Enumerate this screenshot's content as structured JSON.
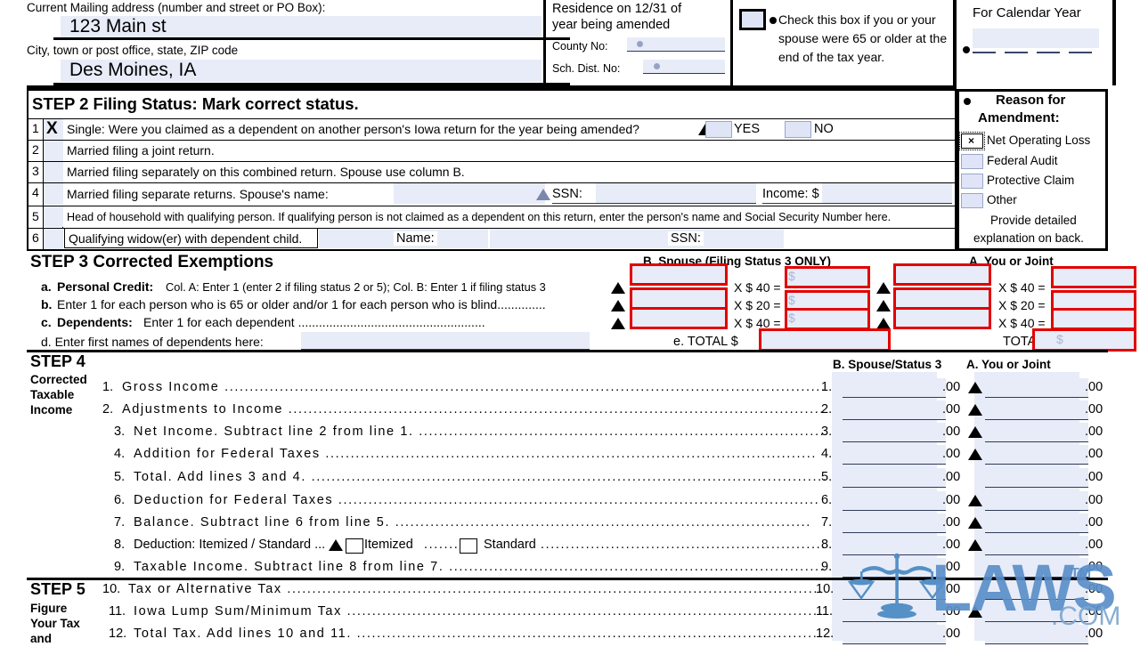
{
  "form": {
    "header": {
      "mailing_address_label": "Current Mailing address (number and street or PO Box):",
      "mailing_address_value": "123 Main st",
      "city_label": "City, town or post office, state, ZIP code",
      "city_value": "Des Moines, IA",
      "residence_label_line1": "Residence on 12/31 of",
      "residence_label_line2": "year being amended",
      "county_label": "County No:",
      "county_value": "",
      "school_label": "Sch. Dist. No:",
      "school_value": "",
      "age_check_text": "Check this box if you or your spouse were 65 or older at the end of the tax year.",
      "calendar_year_label": "For Calendar Year",
      "calendar_year_value": ""
    },
    "step2": {
      "title": "STEP 2 Filing Status: Mark correct status.",
      "rows": [
        {
          "num": "1",
          "mark": "X",
          "text": "Single: Were you claimed as a dependent on another person's Iowa return for the year being amended?"
        },
        {
          "num": "2",
          "mark": "",
          "text": "Married filing a joint return."
        },
        {
          "num": "3",
          "mark": "",
          "text": "Married filing separately on this combined return. Spouse use column B."
        },
        {
          "num": "4",
          "mark": "",
          "text": "Married filing separate returns. Spouse's name:"
        },
        {
          "num": "5",
          "mark": "",
          "text": "Head of household with qualifying person. If qualifying person is not claimed as a dependent on this return, enter the person's name and Social Security Number here."
        },
        {
          "num": "6",
          "mark": "",
          "text": "Qualifying widow(er) with dependent child."
        }
      ],
      "yes_label": "YES",
      "no_label": "NO",
      "ssn_label": "SSN:",
      "income_label": "Income: $",
      "name_label": "Name:",
      "ssn_label2": "SSN:"
    },
    "amendment": {
      "title_line1": "Reason for",
      "title_line2": "Amendment:",
      "options": [
        {
          "label": "Net Operating Loss",
          "checked": true
        },
        {
          "label": "Federal Audit",
          "checked": false
        },
        {
          "label": "Protective Claim",
          "checked": false
        },
        {
          "label": "Other",
          "checked": false
        }
      ],
      "note_line1": "Provide detailed",
      "note_line2": "explanation on back."
    },
    "step3": {
      "title": "STEP 3 Corrected Exemptions",
      "col_b_header": "B. Spouse (Filing Status 3 ONLY)",
      "col_a_header": "A. You or Joint",
      "rows": [
        {
          "key": "a.",
          "bold": "Personal Credit:",
          "text": "Col. A: Enter 1 (enter 2 if filing status 2 or 5); Col. B: Enter 1 if filing status 3",
          "mult": "X $ 40 ="
        },
        {
          "key": "b.",
          "bold": "",
          "text": "Enter 1 for each person who is 65 or older  and/or 1 for each person who is blind",
          "mult": "X $ 20 ="
        },
        {
          "key": "c.",
          "bold": "Dependents:",
          "text": "Enter 1 for each dependent",
          "mult": "X $ 40 ="
        }
      ],
      "row_d_label": "d. Enter first names of dependents here:",
      "row_d_value": "",
      "total_b_label": "e. TOTAL $",
      "total_a_label": "TOTAL $"
    },
    "step4": {
      "title": "STEP 4",
      "side_line1": "Corrected",
      "side_line2": "Taxable",
      "side_line3": "Income",
      "col_b_header": "B. Spouse/Status 3",
      "col_a_header": "A. You or Joint",
      "cents": ".00",
      "lines": [
        {
          "num": "1.",
          "text": "Gross Income",
          "tri": true
        },
        {
          "num": "2.",
          "text": "Adjustments to Income",
          "tri": true
        },
        {
          "num": "3.",
          "text": "Net Income. Subtract line 2 from line 1.",
          "tri": true
        },
        {
          "num": "4.",
          "text": "Addition for Federal Taxes",
          "tri": true
        },
        {
          "num": "5.",
          "text": "Total. Add lines 3 and 4.",
          "tri": false
        },
        {
          "num": "6.",
          "text": "Deduction for Federal Taxes",
          "tri": true
        },
        {
          "num": "7.",
          "text": "Balance. Subtract line 6 from line 5.",
          "tri": true
        },
        {
          "num": "8.",
          "text": "Deduction: Itemized / Standard ...",
          "tri": true
        },
        {
          "num": "9.",
          "text": "Taxable Income. Subtract line 8 from line 7.",
          "tri": false
        }
      ],
      "itemized_label": "Itemized",
      "standard_label": "Standard"
    },
    "step5": {
      "title": "STEP 5",
      "side_line1": "Figure",
      "side_line2": "Your Tax",
      "side_line3": "and",
      "lines": [
        {
          "num": "10.",
          "text": "Tax or Alternative Tax",
          "tri": false
        },
        {
          "num": "11.",
          "text": "Iowa Lump Sum/Minimum Tax",
          "tri": true
        },
        {
          "num": "12.",
          "text": "Total Tax. Add lines 10 and 11.",
          "tri": false
        }
      ]
    },
    "watermark": {
      "brand": "LAWS",
      "tm": "TM",
      "domain": ".COM",
      "logo": "scales-of-justice-icon"
    },
    "colors": {
      "field_fill": "#e7ecf8",
      "red_border": "#e20000",
      "checkbox_fill": "#dfe5f7",
      "watermark_blue": "#5b8fc9"
    }
  }
}
